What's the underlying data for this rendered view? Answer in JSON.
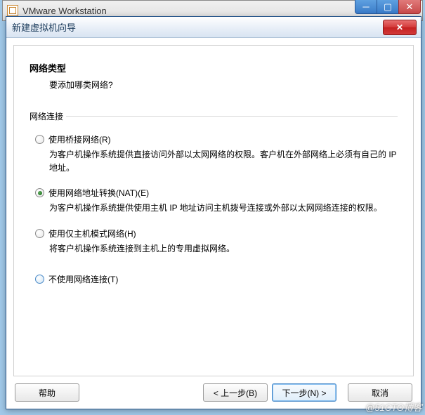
{
  "parent": {
    "title": "VMware Workstation"
  },
  "dialog": {
    "title": "新建虚拟机向导"
  },
  "header": {
    "title": "网络类型",
    "subtitle": "要添加哪类网络?"
  },
  "group": {
    "label": "网络连接"
  },
  "options": [
    {
      "label": "使用桥接网络(R)",
      "description": "为客户机操作系统提供直接访问外部以太网网络的权限。客户机在外部网络上必须有自己的 IP 地址。",
      "selected": false
    },
    {
      "label": "使用网络地址转换(NAT)(E)",
      "description": "为客户机操作系统提供使用主机 IP 地址访问主机拨号连接或外部以太网网络连接的权限。",
      "selected": true
    },
    {
      "label": "使用仅主机模式网络(H)",
      "description": "将客户机操作系统连接到主机上的专用虚拟网络。",
      "selected": false
    },
    {
      "label": "不使用网络连接(T)",
      "description": "",
      "selected": false
    }
  ],
  "buttons": {
    "help": "帮助",
    "back": "< 上一步(B)",
    "next": "下一步(N) >",
    "cancel": "取消"
  },
  "watermark": "@51CTO博客"
}
